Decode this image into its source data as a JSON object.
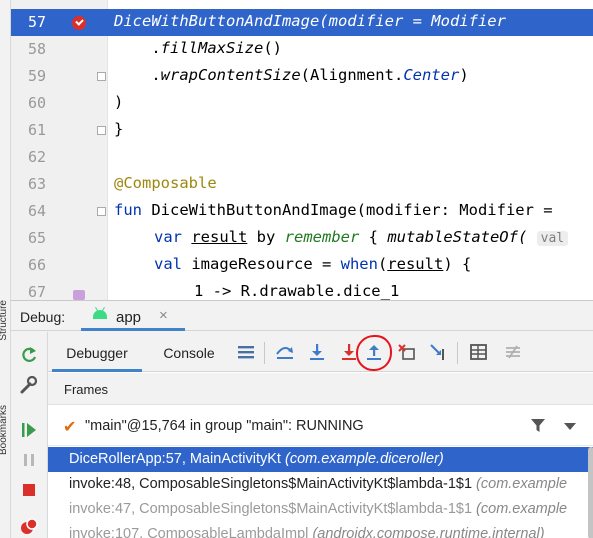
{
  "side_labels": [
    "Structure",
    "Bookmarks"
  ],
  "editor": {
    "lines": [
      {
        "num": "57",
        "current": true
      },
      {
        "num": "58"
      },
      {
        "num": "59"
      },
      {
        "num": "60"
      },
      {
        "num": "61"
      },
      {
        "num": "62"
      },
      {
        "num": "63"
      },
      {
        "num": "64"
      },
      {
        "num": "65"
      },
      {
        "num": "66"
      },
      {
        "num": "67"
      }
    ],
    "code": {
      "l57": "DiceWithButtonAndImage(modifier = Modifier",
      "l58_a": "    .",
      "l58_b": "fillMaxSize",
      "l58_c": "()",
      "l59_a": "    .",
      "l59_b": "wrapContentSize",
      "l59_c": "(Alignment.",
      "l59_d": "Center",
      "l59_e": ")",
      "l60": ")",
      "l61": "}",
      "l63": "@Composable",
      "l64_kw": "fun",
      "l64_rest": " DiceWithButtonAndImage(modifier: Modifier = ",
      "l65_kw": "var",
      "l65_var": "result",
      "l65_by": " by ",
      "l65_fn": "remember",
      "l65_brace": " { ",
      "l65_state": "mutableStateOf(",
      "l65_hint": "val",
      "l66_kw": "val",
      "l66_rest": " imageResource = ",
      "l66_when": "when",
      "l66_paren": "(",
      "l66_var": "result",
      "l66_end": ") {",
      "l67": "1 -> R.drawable.dice_1"
    }
  },
  "debug": {
    "title": "Debug:",
    "tab": "app",
    "tabs": {
      "debugger": "Debugger",
      "console": "Console"
    },
    "frames_title": "Frames",
    "thread": "\"main\"@15,764 in group \"main\": RUNNING",
    "frames": [
      {
        "name": "DiceRollerApp:57, MainActivityKt",
        "pkg": "(com.example.diceroller)",
        "state": "selected"
      },
      {
        "name": "invoke:48, ComposableSingletons$MainActivityKt$lambda-1$1",
        "pkg": "(com.example",
        "state": "normal"
      },
      {
        "name": "invoke:47, ComposableSingletons$MainActivityKt$lambda-1$1",
        "pkg": "(com.example",
        "state": "dim"
      },
      {
        "name": "invoke:107, ComposableLambdaImpl",
        "pkg": "(androidx.compose.runtime.internal)",
        "state": "dim"
      }
    ]
  },
  "colors": {
    "accent": "#2f65ca",
    "annotation_circle": "#e8141c",
    "breakpoint": "#d9302c"
  },
  "icons": [
    "resume-icon",
    "pause-icon",
    "stop-icon",
    "wrench-icon",
    "show-execution-point-icon",
    "step-over-icon",
    "step-into-icon",
    "force-step-into-icon",
    "step-out-icon",
    "drop-frame-icon",
    "run-to-cursor-icon",
    "evaluate-expression-icon",
    "trace-current-stream-chain-icon",
    "filter-icon"
  ]
}
